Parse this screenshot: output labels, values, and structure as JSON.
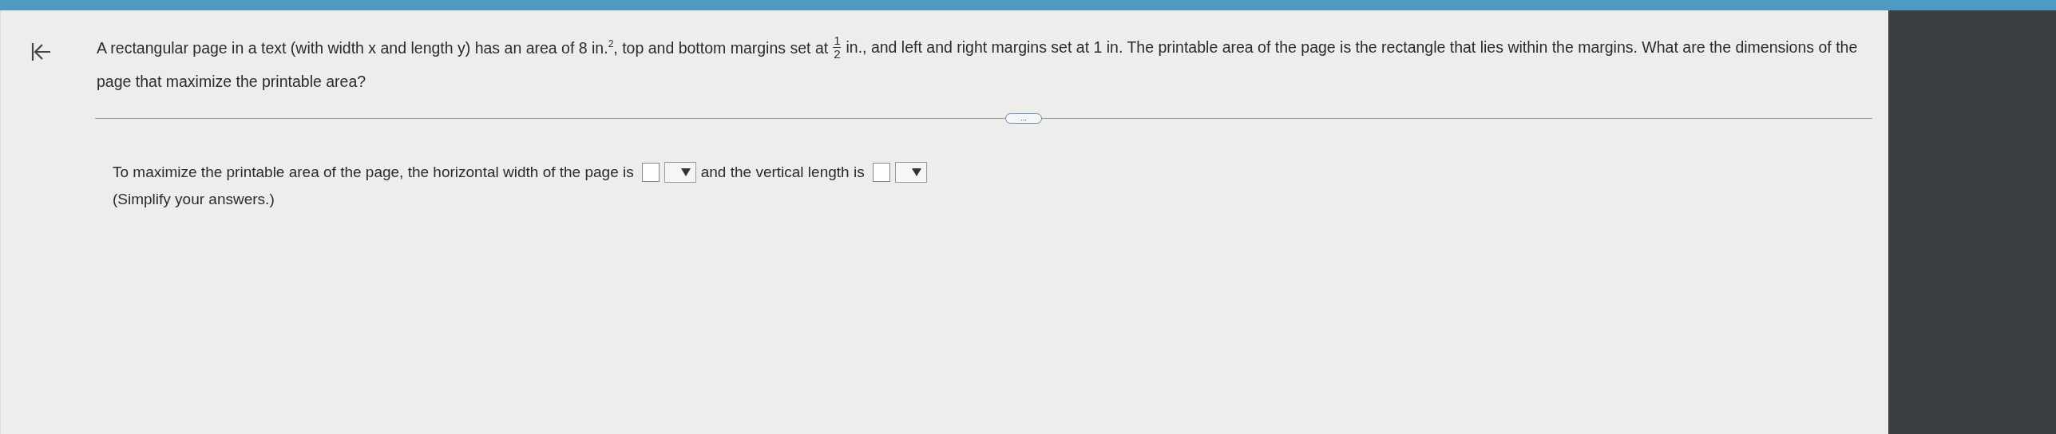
{
  "question": {
    "line_1_before": "A rectangular page in a text (with width x and length y) has an area of 8 in.$^{2}$, top and bottom margins set at",
    "fraction": {
      "numerator": "1",
      "denominator": "2"
    },
    "line_1_after": "in., and left and right margins set at 1 in. The printable area of the page is the rectangle that lies within the margins. What are the dimensions of the",
    "line_2": "page that maximize the printable area?"
  },
  "more_button": "...",
  "answer": {
    "text_1": "To maximize the printable area of the page, the horizontal width of the page is",
    "text_2": "and the vertical length is",
    "hint": "(Simplify your answers.)"
  }
}
